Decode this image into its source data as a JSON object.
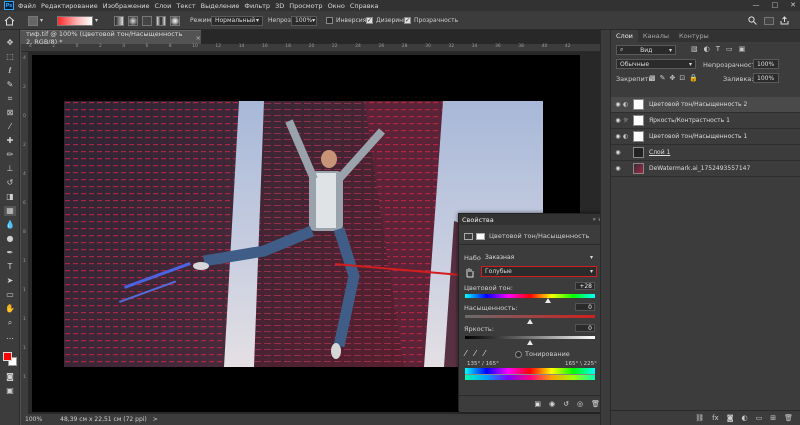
{
  "menu": {
    "logo": "Ps",
    "items": [
      "Файл",
      "Редактирование",
      "Изображение",
      "Слои",
      "Текст",
      "Выделение",
      "Фильтр",
      "3D",
      "Просмотр",
      "Окно",
      "Справка"
    ],
    "window_buttons": [
      "—",
      "□",
      "✕"
    ]
  },
  "options_bar": {
    "mode_label": "Режим:",
    "mode_value": "Нормальный",
    "opacity_label": "Непрозр.:",
    "opacity_value": "100%",
    "invert_label": "Инверсия",
    "dither_label": "Дизеринг",
    "transparency_label": "Прозрачность"
  },
  "document": {
    "tab_title": "тиф.tif @ 100% (Цветовой тон/Насыщенность 2, RGB/8) *",
    "tab_close": "×",
    "ruler_ticks": [
      "4",
      "2",
      "0",
      "2",
      "4",
      "6",
      "8",
      "10",
      "12",
      "14",
      "16",
      "18",
      "20",
      "22",
      "24",
      "26",
      "28",
      "30",
      "32",
      "34",
      "36",
      "38",
      "40",
      "42"
    ],
    "ruler_v_ticks": [
      "4",
      "2",
      "0",
      "2",
      "4",
      "6",
      "8",
      "1",
      "1",
      "1",
      "1",
      "1"
    ]
  },
  "status": {
    "zoom": "100%",
    "doc_size": "48,39 см x 22,51 см (72 ppi)",
    "arrow": ">"
  },
  "layers_panel": {
    "tabs": [
      "Слои",
      "Каналы",
      "Контуры"
    ],
    "search_value": "Вид",
    "blend_mode": "Обычные",
    "opacity_label": "Непрозрачность:",
    "opacity_value": "100%",
    "lock_label": "Закрепить:",
    "fill_label": "Заливка:",
    "fill_value": "100%",
    "layers": [
      {
        "name": "Цветовой тон/Насыщенность 2"
      },
      {
        "name": "Яркость/Контрастность 1"
      },
      {
        "name": "Цветовой тон/Насыщенность 1"
      },
      {
        "name": "Слой 1"
      },
      {
        "name": "DeWatermark.ai_1752493557147"
      }
    ],
    "footer_icons": [
      "link-icon",
      "fx-icon",
      "mask-icon",
      "adjustment-icon",
      "folder-icon",
      "new-layer-icon",
      "trash-icon"
    ]
  },
  "properties_panel": {
    "title": "Свойства",
    "subtitle": "Цветовой тон/Насыщенность",
    "preset_label": "Набор:",
    "preset_value": "Заказная",
    "channel_value": "Голубые",
    "hue_label": "Цветовой тон:",
    "hue_value": "+28",
    "hue_pos": 0.64,
    "saturation_label": "Насыщенность:",
    "saturation_value": "0",
    "saturation_pos": 0.5,
    "lightness_label": "Яркость:",
    "lightness_value": "0",
    "lightness_pos": 0.5,
    "colorize_label": "Тонирование",
    "range_left": "135° / 165°",
    "range_right": "165° \\ 225°"
  },
  "colors": {
    "accent_red": "#d21e1e",
    "ui_dark": "#323232",
    "ui_panel": "#3c3c3c",
    "foreground": "#ff0000",
    "background": "#ffffff"
  }
}
